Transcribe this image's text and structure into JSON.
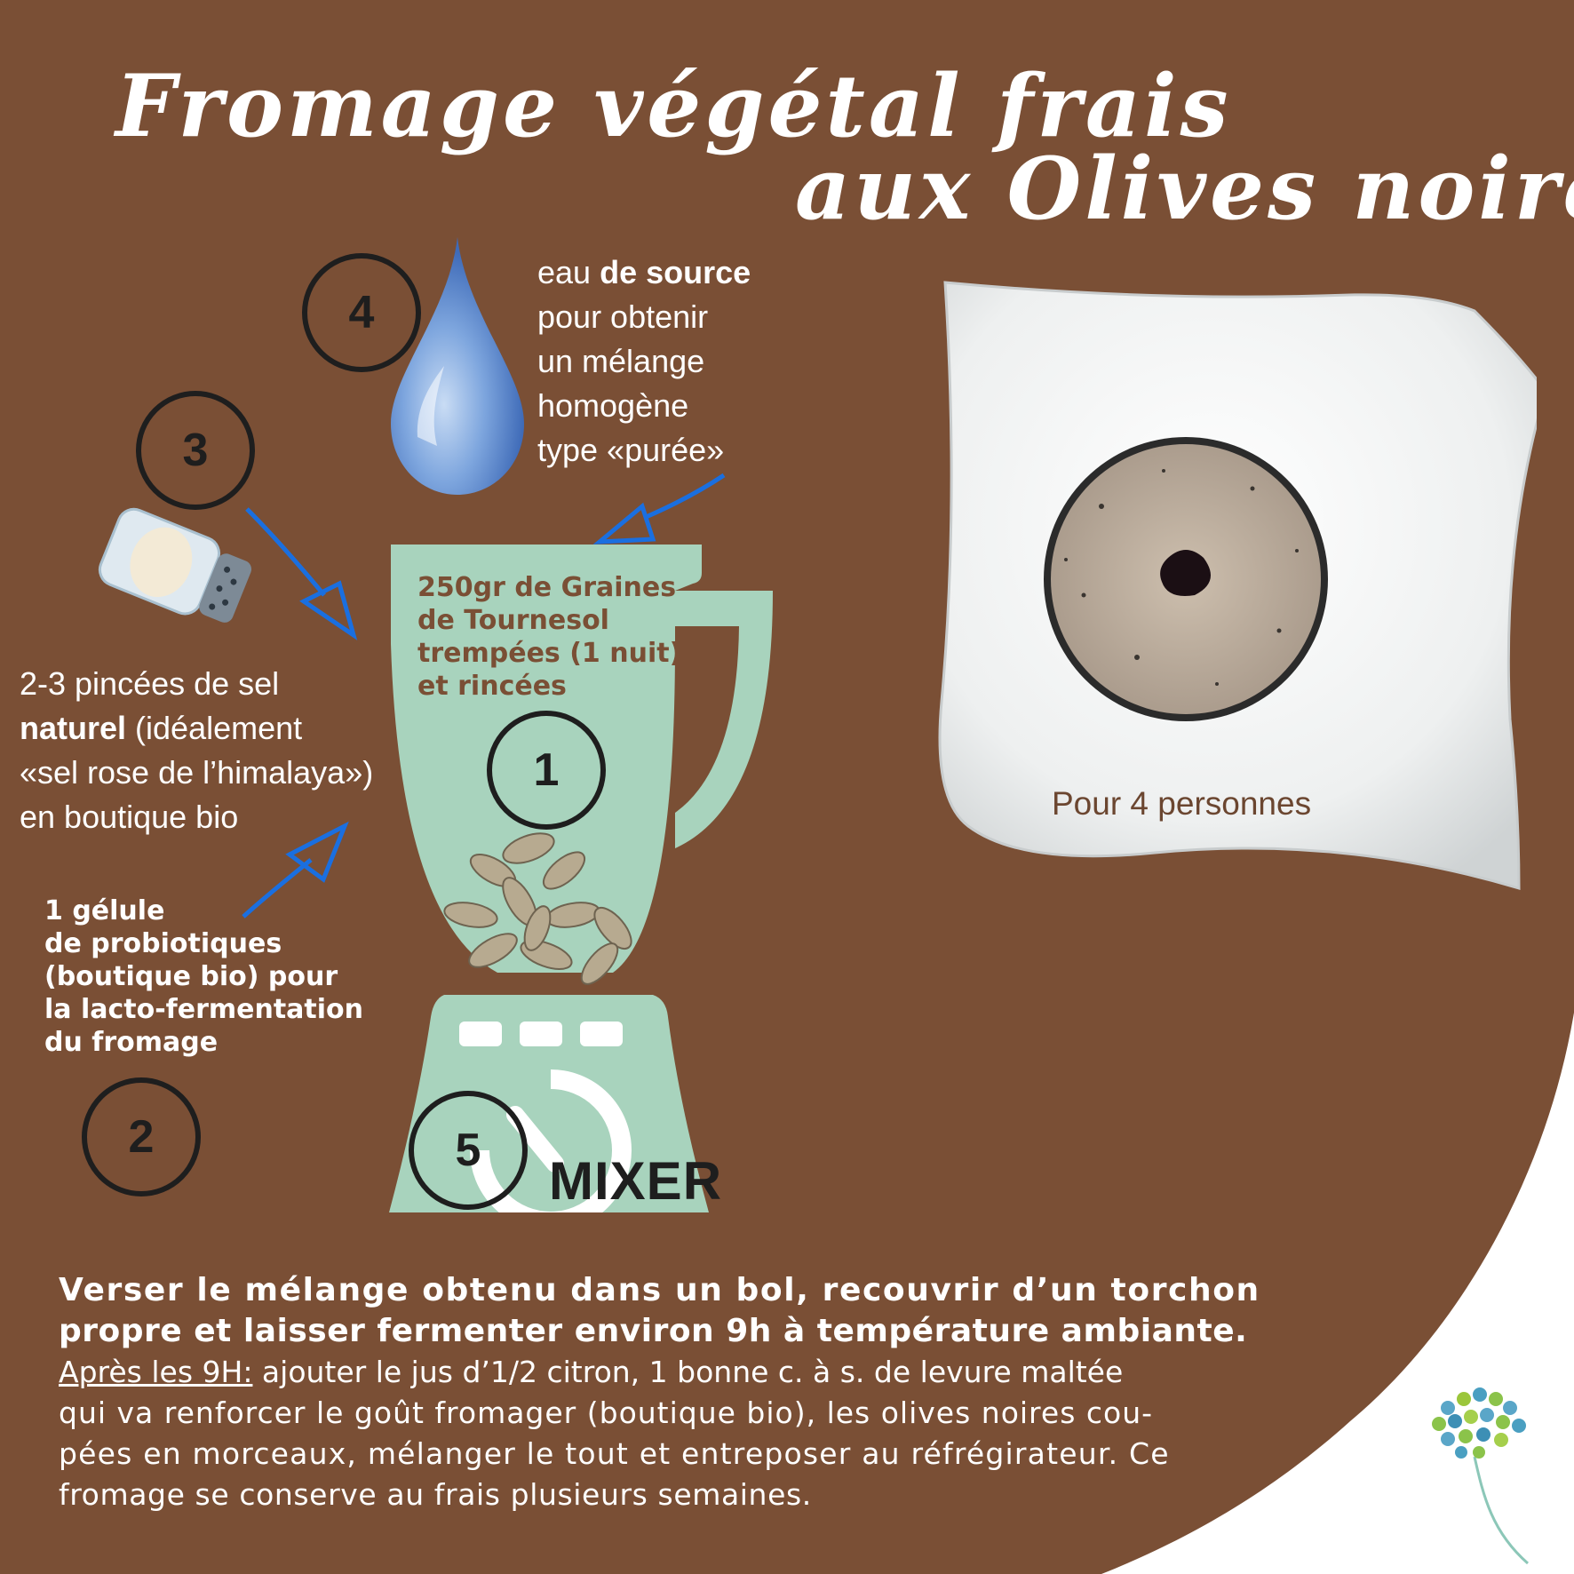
{
  "title": {
    "line1": "Fromage végétal frais",
    "line2": "aux Olives noires"
  },
  "steps": {
    "s1": "1",
    "s2": "2",
    "s3": "3",
    "s4": "4",
    "s5": "5"
  },
  "water": {
    "lines": [
      "eau",
      "de source",
      "pour obtenir",
      "un mélange",
      "homogène",
      "type «purée»"
    ]
  },
  "seeds": {
    "lines": [
      "250gr de Graines",
      "de Tournesol",
      "trempées (1 nuit)",
      "et rincées"
    ]
  },
  "salt": {
    "line1": "2-3 pincées de sel",
    "line2_bold": "naturel",
    "line2_rest": " (idéalement",
    "line3": "«sel rose de l’himalaya»)",
    "line4": "en boutique bio"
  },
  "probiotic": {
    "lines": [
      "1 gélule",
      "de probiotiques",
      "(boutique bio) pour",
      "la lacto-fermentation",
      "du fromage"
    ]
  },
  "mixer_label": "MIXER",
  "servings": "Pour 4 personnes",
  "instructions": {
    "p1_lines": [
      "Verser le mélange obtenu dans un bol, recouvrir d’un torchon",
      "propre et laisser fermenter environ 9h à température ambiante."
    ],
    "p2_label": "Après les 9H:",
    "p2_first_rest": " ajouter le jus d’1/2 citron, 1 bonne c. à s. de levure maltée",
    "p2_lines": [
      "qui va renforcer le goût fromager (boutique bio), les olives noires cou-",
      "pées en morceaux, mélanger le tout et entreposer au réfrégirateur. Ce",
      "fromage se conserve au frais plusieurs semaines."
    ]
  },
  "colors": {
    "background": "#7a4f35",
    "mixer": "#a8d3bd",
    "arrow": "#1a6fe0",
    "text": "#ffffff",
    "circle": "#1e1e1e"
  }
}
